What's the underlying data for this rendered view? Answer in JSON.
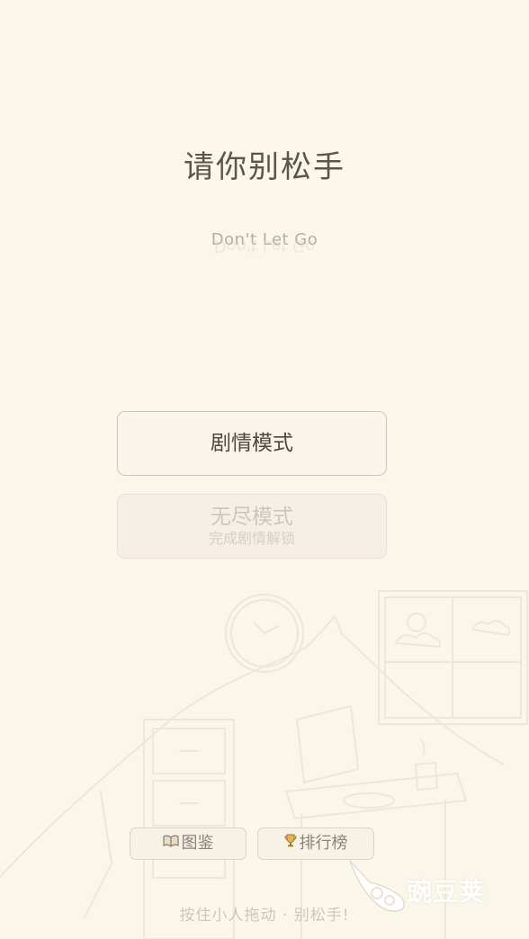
{
  "header": {
    "title": "请你别松手",
    "subtitle": "Don't Let Go"
  },
  "menu": {
    "story_mode": "剧情模式",
    "endless_mode": "无尽模式",
    "endless_locked_hint": "完成剧情解锁"
  },
  "bottom": {
    "catalog_label": "图鉴",
    "catalog_icon": "book-icon",
    "leaderboard_label": "排行榜",
    "leaderboard_icon": "trophy-icon",
    "hint": "按住小人拖动 · 别松手!"
  },
  "watermark": {
    "text": "豌豆荚"
  },
  "colors": {
    "background": "#fbf6ea",
    "title": "#5d544a",
    "button_border": "#cdc4b7",
    "disabled_text": "#cfc6ba"
  }
}
